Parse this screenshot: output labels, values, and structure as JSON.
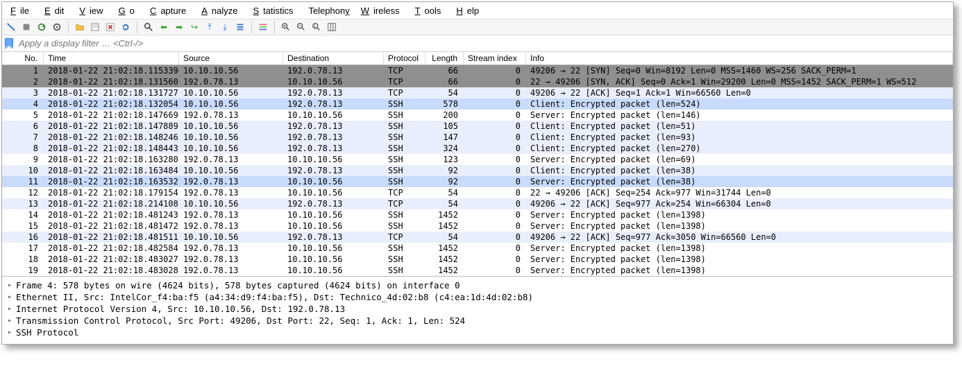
{
  "menu": {
    "file": "File",
    "edit": "Edit",
    "view": "View",
    "go": "Go",
    "capture": "Capture",
    "analyze": "Analyze",
    "statistics": "Statistics",
    "telephony": "Telephony",
    "wireless": "Wireless",
    "tools": "Tools",
    "help": "Help"
  },
  "filter": {
    "placeholder": "Apply a display filter … <Ctrl-/>"
  },
  "columns": {
    "no": "No.",
    "time": "Time",
    "source": "Source",
    "destination": "Destination",
    "protocol": "Protocol",
    "length": "Length",
    "stream": "Stream index",
    "info": "Info"
  },
  "rows": [
    {
      "no": "1",
      "time": "2018-01-22 21:02:18.115339",
      "src": "10.10.10.56",
      "dst": "192.0.78.13",
      "proto": "TCP",
      "len": "66",
      "stream": "0",
      "info": "49206 → 22 [SYN] Seq=0 Win=8192 Len=0 MSS=1460 WS=256 SACK_PERM=1",
      "cls": "sel"
    },
    {
      "no": "2",
      "time": "2018-01-22 21:02:18.131560",
      "src": "192.0.78.13",
      "dst": "10.10.10.56",
      "proto": "TCP",
      "len": "66",
      "stream": "0",
      "info": "22 → 49206 [SYN, ACK] Seq=0 Ack=1 Win=29200 Len=0 MSS=1452 SACK_PERM=1 WS=512",
      "cls": "sel"
    },
    {
      "no": "3",
      "time": "2018-01-22 21:02:18.131727",
      "src": "10.10.10.56",
      "dst": "192.0.78.13",
      "proto": "TCP",
      "len": "54",
      "stream": "0",
      "info": "49206 → 22 [ACK] Seq=1 Ack=1 Win=66560 Len=0",
      "cls": "lblue"
    },
    {
      "no": "4",
      "time": "2018-01-22 21:02:18.132054",
      "src": "10.10.10.56",
      "dst": "192.0.78.13",
      "proto": "SSH",
      "len": "578",
      "stream": "0",
      "info": "Client: Encrypted packet (len=524)",
      "cls": "hl"
    },
    {
      "no": "5",
      "time": "2018-01-22 21:02:18.147669",
      "src": "192.0.78.13",
      "dst": "10.10.10.56",
      "proto": "SSH",
      "len": "200",
      "stream": "0",
      "info": "Server: Encrypted packet (len=146)",
      "cls": "white"
    },
    {
      "no": "6",
      "time": "2018-01-22 21:02:18.147889",
      "src": "10.10.10.56",
      "dst": "192.0.78.13",
      "proto": "SSH",
      "len": "105",
      "stream": "0",
      "info": "Client: Encrypted packet (len=51)",
      "cls": "lblue"
    },
    {
      "no": "7",
      "time": "2018-01-22 21:02:18.148246",
      "src": "10.10.10.56",
      "dst": "192.0.78.13",
      "proto": "SSH",
      "len": "147",
      "stream": "0",
      "info": "Client: Encrypted packet (len=93)",
      "cls": "lblue"
    },
    {
      "no": "8",
      "time": "2018-01-22 21:02:18.148443",
      "src": "10.10.10.56",
      "dst": "192.0.78.13",
      "proto": "SSH",
      "len": "324",
      "stream": "0",
      "info": "Client: Encrypted packet (len=270)",
      "cls": "lblue"
    },
    {
      "no": "9",
      "time": "2018-01-22 21:02:18.163280",
      "src": "192.0.78.13",
      "dst": "10.10.10.56",
      "proto": "SSH",
      "len": "123",
      "stream": "0",
      "info": "Server: Encrypted packet (len=69)",
      "cls": "white"
    },
    {
      "no": "10",
      "time": "2018-01-22 21:02:18.163484",
      "src": "10.10.10.56",
      "dst": "192.0.78.13",
      "proto": "SSH",
      "len": "92",
      "stream": "0",
      "info": "Client: Encrypted packet (len=38)",
      "cls": "lblue"
    },
    {
      "no": "11",
      "time": "2018-01-22 21:02:18.163532",
      "src": "192.0.78.13",
      "dst": "10.10.10.56",
      "proto": "SSH",
      "len": "92",
      "stream": "0",
      "info": "Server: Encrypted packet (len=38)",
      "cls": "hl"
    },
    {
      "no": "12",
      "time": "2018-01-22 21:02:18.179154",
      "src": "192.0.78.13",
      "dst": "10.10.10.56",
      "proto": "TCP",
      "len": "54",
      "stream": "0",
      "info": "22 → 49206 [ACK] Seq=254 Ack=977 Win=31744 Len=0",
      "cls": "white"
    },
    {
      "no": "13",
      "time": "2018-01-22 21:02:18.214108",
      "src": "10.10.10.56",
      "dst": "192.0.78.13",
      "proto": "TCP",
      "len": "54",
      "stream": "0",
      "info": "49206 → 22 [ACK] Seq=977 Ack=254 Win=66304 Len=0",
      "cls": "lblue"
    },
    {
      "no": "14",
      "time": "2018-01-22 21:02:18.481243",
      "src": "192.0.78.13",
      "dst": "10.10.10.56",
      "proto": "SSH",
      "len": "1452",
      "stream": "0",
      "info": "Server: Encrypted packet (len=1398)",
      "cls": "white"
    },
    {
      "no": "15",
      "time": "2018-01-22 21:02:18.481472",
      "src": "192.0.78.13",
      "dst": "10.10.10.56",
      "proto": "SSH",
      "len": "1452",
      "stream": "0",
      "info": "Server: Encrypted packet (len=1398)",
      "cls": "white"
    },
    {
      "no": "16",
      "time": "2018-01-22 21:02:18.481511",
      "src": "10.10.10.56",
      "dst": "192.0.78.13",
      "proto": "TCP",
      "len": "54",
      "stream": "0",
      "info": "49206 → 22 [ACK] Seq=977 Ack=3050 Win=66560 Len=0",
      "cls": "lblue"
    },
    {
      "no": "17",
      "time": "2018-01-22 21:02:18.482584",
      "src": "192.0.78.13",
      "dst": "10.10.10.56",
      "proto": "SSH",
      "len": "1452",
      "stream": "0",
      "info": "Server: Encrypted packet (len=1398)",
      "cls": "white"
    },
    {
      "no": "18",
      "time": "2018-01-22 21:02:18.483027",
      "src": "192.0.78.13",
      "dst": "10.10.10.56",
      "proto": "SSH",
      "len": "1452",
      "stream": "0",
      "info": "Server: Encrypted packet (len=1398)",
      "cls": "white"
    },
    {
      "no": "19",
      "time": "2018-01-22 21:02:18.483028",
      "src": "192.0.78.13",
      "dst": "10.10.10.56",
      "proto": "SSH",
      "len": "1452",
      "stream": "0",
      "info": "Server: Encrypted packet (len=1398)",
      "cls": "white"
    }
  ],
  "details": {
    "l0": "Frame 4: 578 bytes on wire (4624 bits), 578 bytes captured (4624 bits) on interface 0",
    "l1": "Ethernet II, Src: IntelCor_f4:ba:f5 (a4:34:d9:f4:ba:f5), Dst: Technico_4d:02:b8 (c4:ea:1d:4d:02:b8)",
    "l2": "Internet Protocol Version 4, Src: 10.10.10.56, Dst: 192.0.78.13",
    "l3": "Transmission Control Protocol, Src Port: 49206, Dst Port: 22, Seq: 1, Ack: 1, Len: 524",
    "l4": "SSH Protocol"
  }
}
